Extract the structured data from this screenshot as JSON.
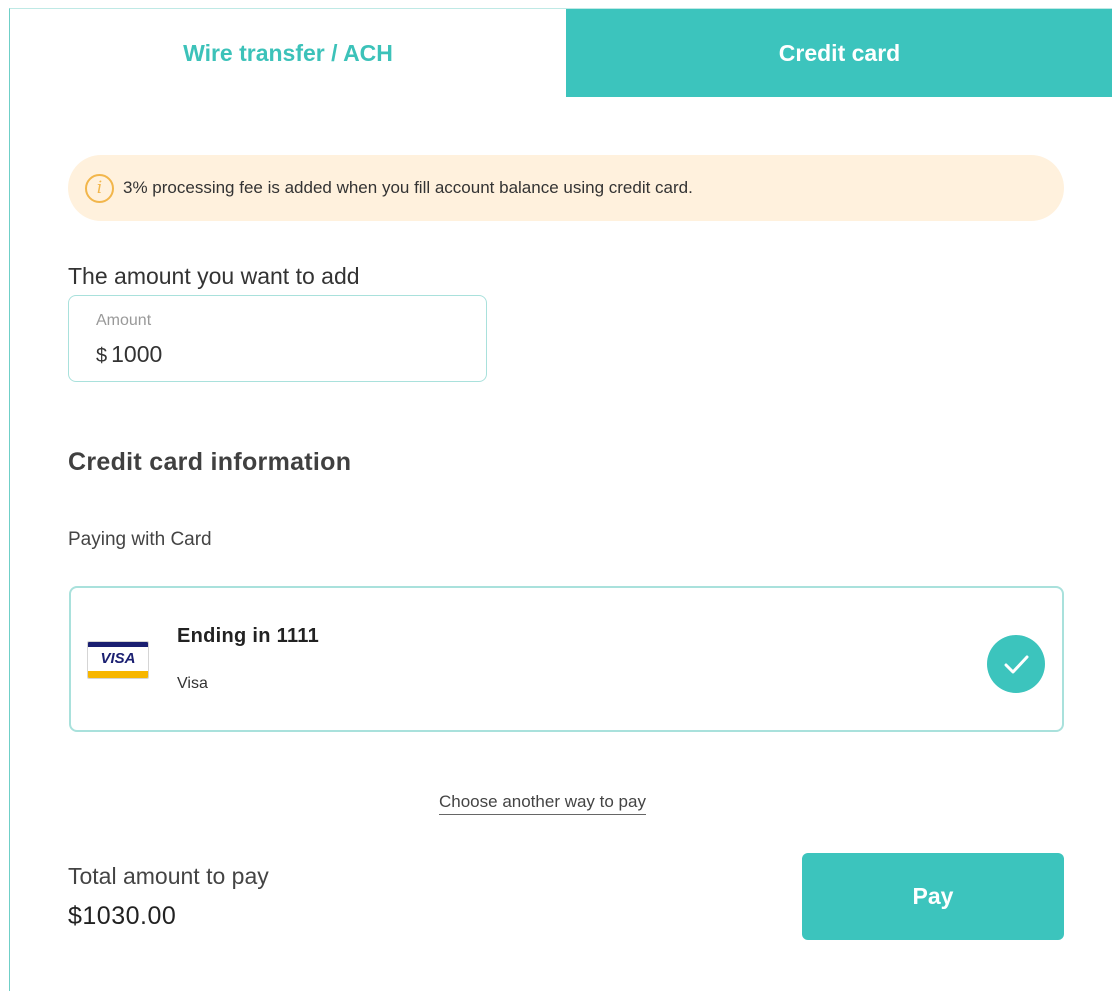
{
  "tabs": {
    "wire_label": "Wire transfer / ACH",
    "card_label": "Credit card",
    "active": "Credit card"
  },
  "notice": {
    "icon": "info-icon",
    "icon_glyph": "i",
    "text": "3% processing fee is added when you fill account balance using credit card."
  },
  "amount": {
    "label": "The amount you want to add",
    "placeholder": "Amount",
    "currency": "$",
    "value": "1000"
  },
  "credit_card": {
    "heading": "Credit card information",
    "paying_label": "Paying with Card",
    "card": {
      "brand_logo": "VISA",
      "title": "Ending in 1111",
      "brand": "Visa",
      "selected": true
    },
    "another_way": "Choose another way to pay"
  },
  "total": {
    "label": "Total amount to pay",
    "value": "$1030.00"
  },
  "pay_button": "Pay",
  "colors": {
    "accent": "#3cc4bd",
    "notice_bg": "#fff1dd",
    "notice_icon": "#f2b64b",
    "visa_blue": "#1a1f71",
    "visa_gold": "#f7b600"
  }
}
